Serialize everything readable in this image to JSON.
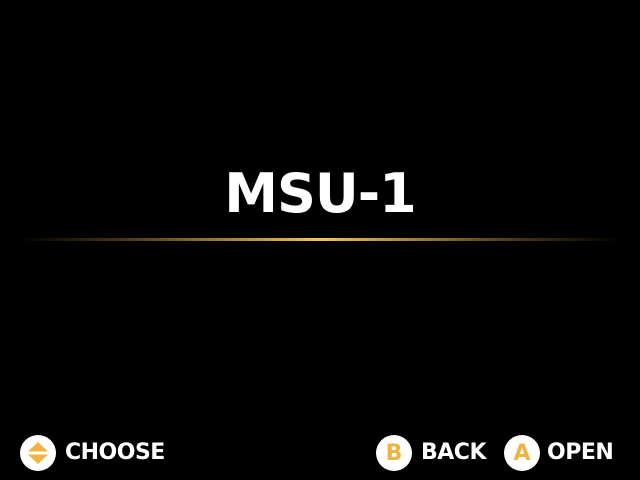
{
  "screen": {
    "title": "MSU-1",
    "accent_color": "#f0b443",
    "background_color": "#000000"
  },
  "footer": {
    "choose": {
      "icon": "dpad-up-down-icon",
      "label": "CHOOSE"
    },
    "back": {
      "button": "B",
      "label": "BACK"
    },
    "open": {
      "button": "A",
      "label": "OPEN"
    }
  }
}
